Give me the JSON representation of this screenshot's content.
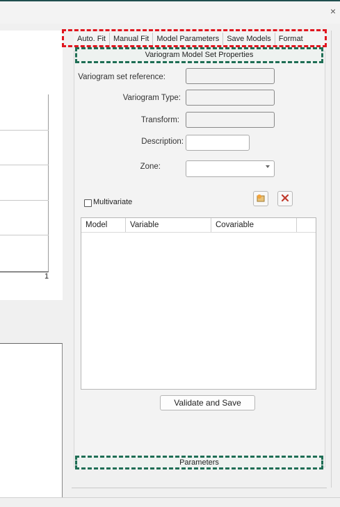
{
  "window": {
    "close_glyph": "×"
  },
  "chart": {
    "tick_label": "1"
  },
  "tabs": [
    {
      "label": "Auto. Fit"
    },
    {
      "label": "Manual Fit"
    },
    {
      "label": "Model Parameters"
    },
    {
      "label": "Save Models"
    },
    {
      "label": "Format"
    }
  ],
  "section": {
    "title": "Variogram Model Set Properties"
  },
  "form": {
    "reference_label": "Variogram set reference:",
    "reference_value": "",
    "type_label": "Variogram Type:",
    "type_value": "",
    "transform_label": "Transform:",
    "transform_value": "",
    "description_label": "Description:",
    "description_value": "",
    "zone_label": "Zone:",
    "zone_value": ""
  },
  "multivariate": {
    "label": "Multivariate",
    "checked": false
  },
  "icons": {
    "add": "add-model-icon",
    "delete": "delete-icon"
  },
  "table": {
    "columns": [
      "Model",
      "Variable",
      "Covariable"
    ],
    "rows": []
  },
  "actions": {
    "validate_label": "Validate and Save"
  },
  "parameters": {
    "title": "Parameters"
  },
  "colors": {
    "highlight_red": "#e0161f",
    "highlight_green": "#1f6e55",
    "delete_red": "#c0392b"
  }
}
